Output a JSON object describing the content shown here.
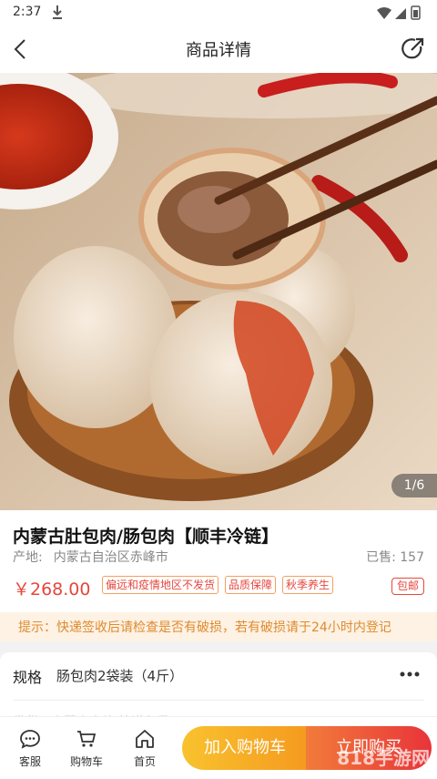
{
  "status_bar": {
    "time": "2:37"
  },
  "nav": {
    "title": "商品详情"
  },
  "gallery": {
    "indicator": "1/6"
  },
  "product": {
    "name": "内蒙古肚包肉/肠包肉【顺丰冷链】",
    "origin_label": "产地:",
    "origin_value": "内蒙古自治区赤峰市",
    "sold": "已售:  157",
    "price": "￥268.00",
    "tags": [
      "偏远和疫情地区不发货",
      "品质保障",
      "秋季养生"
    ],
    "shipping_badge": "包邮"
  },
  "notice": {
    "text": "提示：快递签收后请检查是否有破损，若有破损请于24小时内登记"
  },
  "spec": {
    "label": "规格",
    "value": "肠包肉2袋装（4斤）",
    "partial_row": "发货：内蒙古赤峰 快递免费"
  },
  "bottom_bar": {
    "tabs": [
      {
        "label": "客服",
        "icon": "chat-icon"
      },
      {
        "label": "购物车",
        "icon": "cart-icon"
      },
      {
        "label": "首页",
        "icon": "home-icon"
      }
    ],
    "add_cart": "加入购物车",
    "buy_now": "立即购买"
  },
  "watermark": "818手游网",
  "colors": {
    "accent": "#e5473e",
    "tag_border": "#f0a060",
    "notice_bg": "#fdf2e4",
    "notice_text": "#e08a2e"
  }
}
